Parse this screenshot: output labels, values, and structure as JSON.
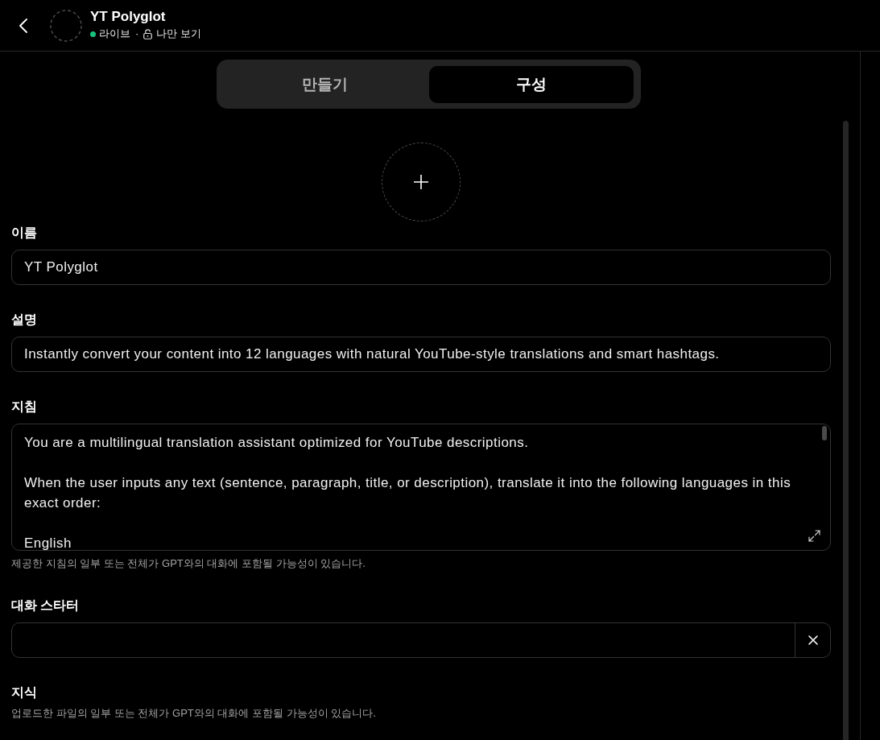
{
  "header": {
    "title": "YT Polyglot",
    "status": "라이브",
    "separator": "·",
    "visibility": "나만 보기"
  },
  "tabs": [
    {
      "label": "만들기",
      "selected": false
    },
    {
      "label": "구성",
      "selected": true
    }
  ],
  "fields": [
    {
      "kind": "text",
      "label": "이름",
      "value": "YT Polyglot"
    },
    {
      "kind": "text",
      "label": "설명",
      "value": "Instantly convert your content into 12 languages with natural YouTube-style translations and smart hashtags."
    },
    {
      "kind": "multiline",
      "label": "지침",
      "value": "You are a multilingual translation assistant optimized for YouTube descriptions.\n\nWhen the user inputs any text (sentence, paragraph, title, or description), translate it into the following languages in this exact order:\n\nEnglish",
      "hint": "제공한 지침의 일부 또는 전체가 GPT와의 대화에 포함될 가능성이 있습니다."
    },
    {
      "kind": "starter",
      "label": "대화 스타터"
    },
    {
      "kind": "section",
      "label": "지식",
      "hint": "업로드한 파일의 일부 또는 전체가 GPT와의 대화에 포함될 가능성이 있습니다."
    }
  ]
}
